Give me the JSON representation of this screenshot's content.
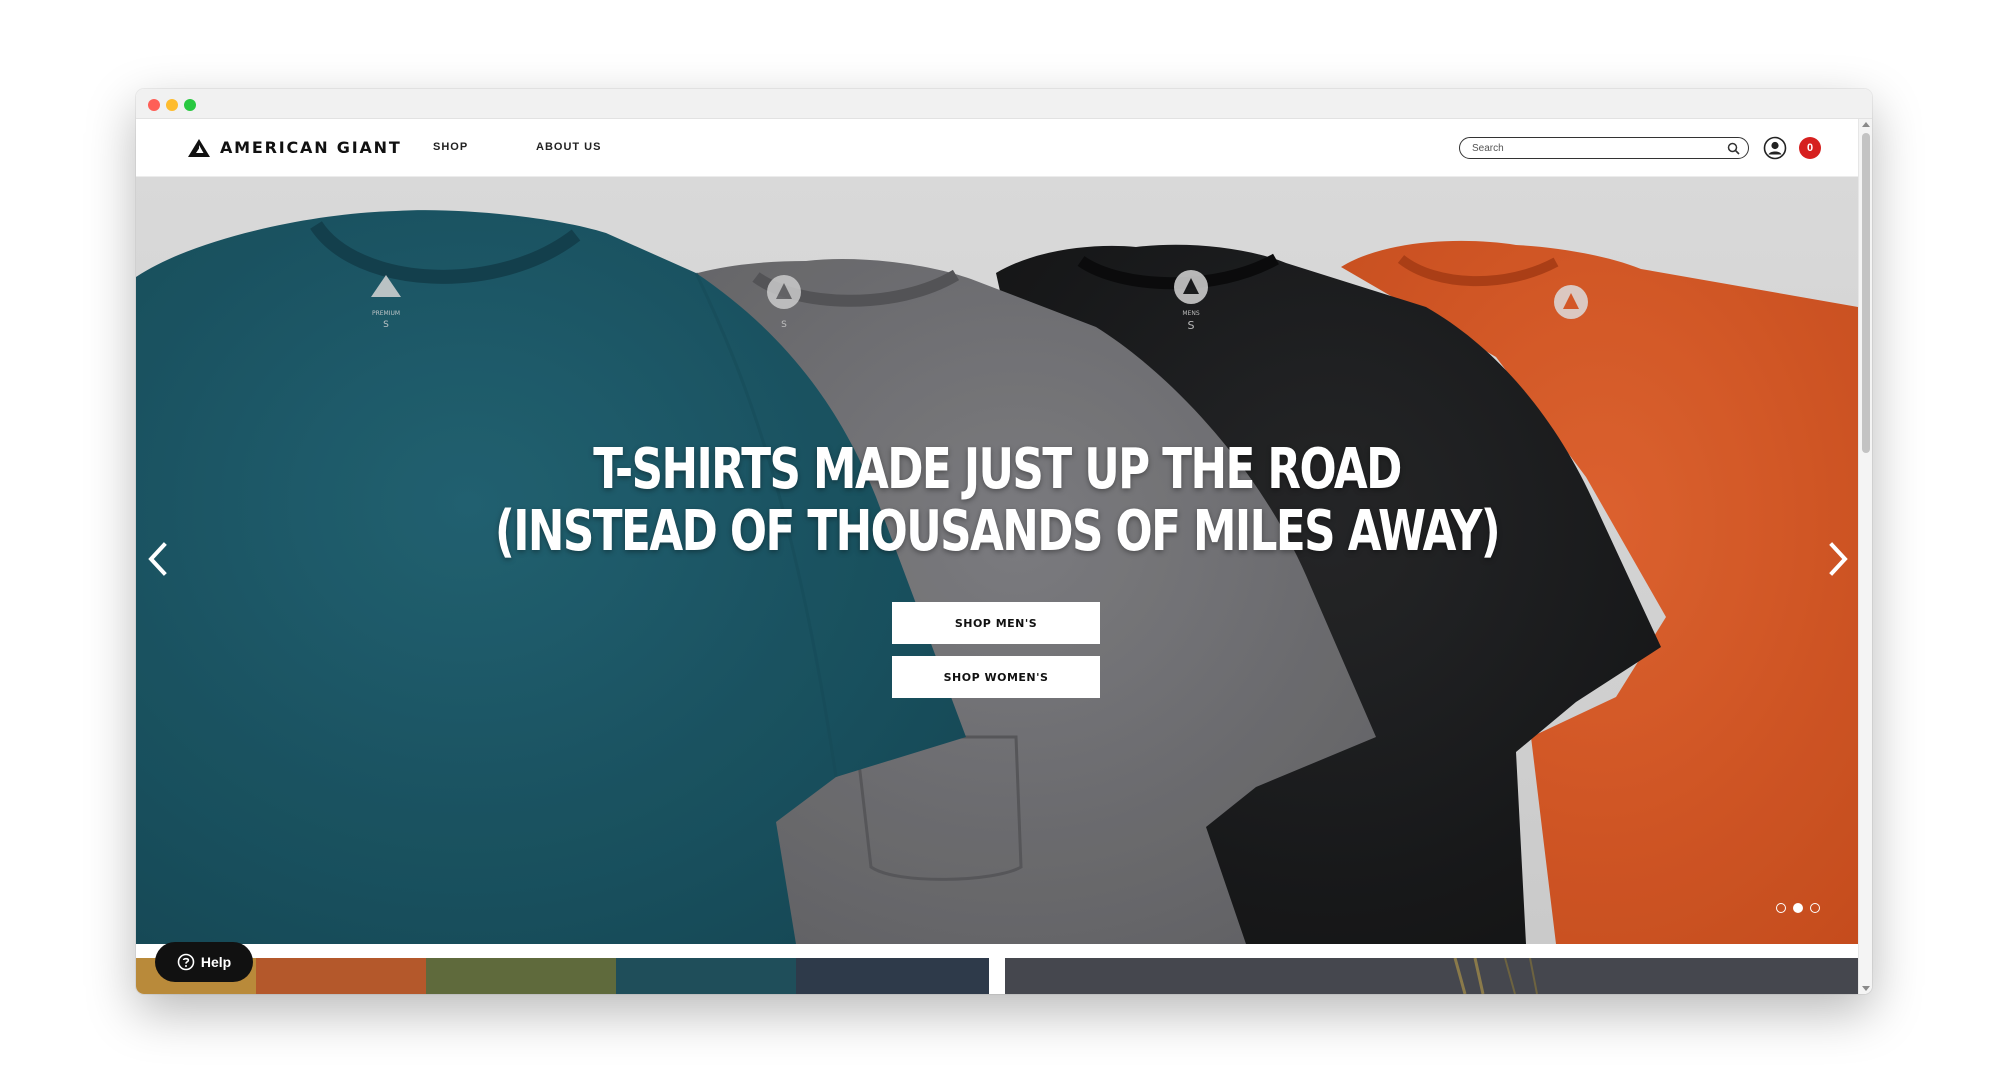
{
  "header": {
    "brand": "AMERICAN GIANT",
    "nav": [
      {
        "label": "SHOP"
      },
      {
        "label": "ABOUT US"
      }
    ],
    "search_placeholder": "Search",
    "cart_count": "0",
    "icons": {
      "logo": "triangle-logo-icon",
      "search": "search-icon",
      "account": "user-icon"
    }
  },
  "hero": {
    "title_line1": "T-SHIRTS MADE JUST UP THE ROAD",
    "title_line2": "(INSTEAD OF THOUSANDS OF MILES AWAY)",
    "buttons": {
      "men": "SHOP MEN'S",
      "women": "SHOP WOMEN'S"
    },
    "slides": 3,
    "active_slide": 2,
    "shirt_colors": [
      "#1f5f70",
      "#7c7c80",
      "#1e1f21",
      "#e65f2b"
    ],
    "shirt_tags": [
      {
        "size": "S",
        "line": "PREMIUM"
      },
      {
        "size": "S",
        "line": ""
      },
      {
        "size": "S",
        "line": "MENS"
      },
      {
        "size": "",
        "line": ""
      }
    ]
  },
  "help": {
    "label": "Help"
  },
  "colors": {
    "cart_badge": "#d6201f",
    "help_bg": "#111111"
  }
}
